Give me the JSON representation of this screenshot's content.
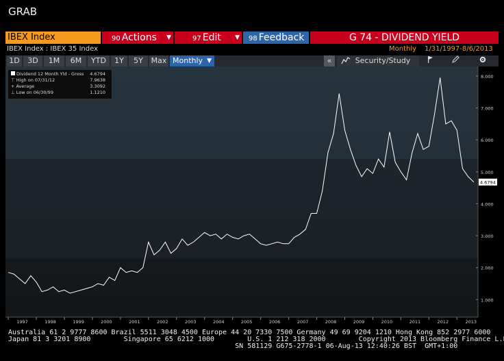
{
  "window_title": "GRAB",
  "header": {
    "security": "IBEX Index",
    "actions": {
      "num": "90",
      "label": "Actions"
    },
    "edit": {
      "num": "97",
      "label": "Edit"
    },
    "feedback": {
      "num": "98",
      "label": "Feedback"
    },
    "function_title": "G 74 - DIVIDEND YIELD"
  },
  "subheader": {
    "subtitle": "IBEX Index : IBEX 35 Index",
    "period": "Monthly",
    "date_range": "1/31/1997-8/6/2013"
  },
  "toolbar": {
    "ranges": [
      "1D",
      "3D",
      "1M",
      "6M",
      "YTD",
      "1Y",
      "5Y",
      "Max"
    ],
    "frequency": "Monthly",
    "collapse": "«",
    "security_study": "Security/Study"
  },
  "legend": {
    "rows": [
      {
        "label": "Dividend 12 Month Yld - Gross",
        "value": "4.6794"
      },
      {
        "label": "High on 07/31/12",
        "value": "7.9638"
      },
      {
        "label": "Average",
        "value": "3.3092"
      },
      {
        "label": "Low on 06/30/99",
        "value": "1.1210"
      }
    ]
  },
  "chart_data": {
    "type": "line",
    "title": "",
    "series": [
      {
        "name": "Dividend 12 Month Yld - Gross",
        "color": "#ffffff",
        "x": [
          1997.0,
          1997.2,
          1997.4,
          1997.6,
          1997.8,
          1998.0,
          1998.2,
          1998.4,
          1998.6,
          1998.8,
          1999.0,
          1999.2,
          1999.4,
          1999.6,
          1999.8,
          2000.0,
          2000.2,
          2000.4,
          2000.6,
          2000.8,
          2001.0,
          2001.2,
          2001.4,
          2001.6,
          2001.8,
          2002.0,
          2002.2,
          2002.4,
          2002.6,
          2002.8,
          2003.0,
          2003.2,
          2003.4,
          2003.6,
          2003.8,
          2004.0,
          2004.2,
          2004.4,
          2004.6,
          2004.8,
          2005.0,
          2005.2,
          2005.4,
          2005.6,
          2005.8,
          2006.0,
          2006.2,
          2006.4,
          2006.6,
          2006.8,
          2007.0,
          2007.2,
          2007.4,
          2007.6,
          2007.8,
          2008.0,
          2008.2,
          2008.4,
          2008.6,
          2008.8,
          2009.0,
          2009.2,
          2009.4,
          2009.6,
          2009.8,
          2010.0,
          2010.2,
          2010.4,
          2010.6,
          2010.8,
          2011.0,
          2011.2,
          2011.4,
          2011.6,
          2011.8,
          2012.0,
          2012.2,
          2012.4,
          2012.6,
          2012.8,
          2013.0,
          2013.2,
          2013.4,
          2013.6
        ],
        "y": [
          1.85,
          1.8,
          1.65,
          1.5,
          1.75,
          1.55,
          1.25,
          1.3,
          1.4,
          1.25,
          1.3,
          1.2,
          1.25,
          1.3,
          1.35,
          1.4,
          1.5,
          1.45,
          1.7,
          1.6,
          2.0,
          1.85,
          1.9,
          1.85,
          2.0,
          2.8,
          2.4,
          2.55,
          2.8,
          2.45,
          2.6,
          2.9,
          2.7,
          2.8,
          2.95,
          3.1,
          3.0,
          3.05,
          2.9,
          3.05,
          2.95,
          2.9,
          3.0,
          3.05,
          2.9,
          2.75,
          2.7,
          2.75,
          2.8,
          2.75,
          2.75,
          2.95,
          3.05,
          3.2,
          3.7,
          3.7,
          4.4,
          5.6,
          6.2,
          7.45,
          6.3,
          5.7,
          5.2,
          4.85,
          5.1,
          4.95,
          5.4,
          5.15,
          6.25,
          5.3,
          5.0,
          4.75,
          5.6,
          6.2,
          5.7,
          5.8,
          6.8,
          7.95,
          6.5,
          6.6,
          6.3,
          5.1,
          4.85,
          4.68
        ]
      }
    ],
    "xticks": [
      "1997",
      "1998",
      "1999",
      "2000",
      "2001",
      "2002",
      "2003",
      "2004",
      "2005",
      "2006",
      "2007",
      "2008",
      "2009",
      "2010",
      "2011",
      "2012",
      "2013"
    ],
    "yticks": [
      "1.000",
      "2.000",
      "3.000",
      "4.000",
      "5.000",
      "6.000",
      "7.000",
      "8.000"
    ],
    "xlim": [
      1996.9,
      2013.75
    ],
    "ylim": [
      0.45,
      8.3
    ],
    "last_value_label": "4.6794",
    "grid": false
  },
  "footer": {
    "line1": "Australia 61 2 9777 8600 Brazil 5511 3048 4500 Europe 44 20 7330 7500 Germany 49 69 9204 1210 Hong Kong 852 2977 6000",
    "line2": "Japan 81 3 3201 8900        Singapore 65 6212 1000        U.S. 1 212 318 2000        Copyright 2013 Bloomberg Finance L.P.",
    "line3": "                                                       SN 581129 G675-2778-1 06-Aug-13 12:40:26 BST  GMT+1:00"
  }
}
